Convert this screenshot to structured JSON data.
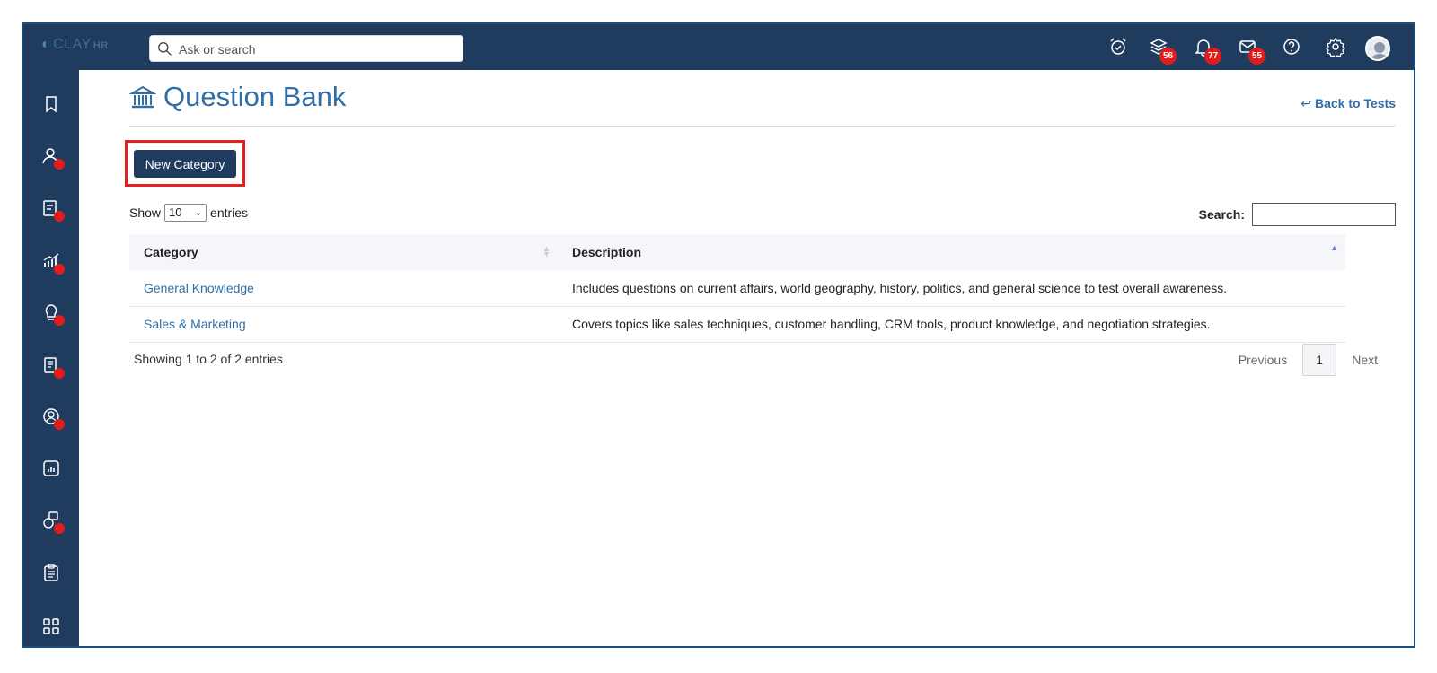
{
  "app": {
    "logo_text": "CLAY",
    "logo_suffix": "HR"
  },
  "search": {
    "placeholder": "Ask or search"
  },
  "topbar": {
    "icons": [
      "alarm-clock-icon",
      "layers-icon",
      "bell-icon",
      "mail-icon",
      "help-icon",
      "settings-icon"
    ],
    "badges": {
      "layers": "56",
      "bell": "77",
      "mail": "55"
    }
  },
  "sidebar": {
    "items": [
      {
        "icon": "bookmark-icon",
        "dot": false
      },
      {
        "icon": "people-icon",
        "dot": true
      },
      {
        "icon": "attendance-icon",
        "dot": true
      },
      {
        "icon": "growth-chart-icon",
        "dot": true
      },
      {
        "icon": "lightbulb-icon",
        "dot": true
      },
      {
        "icon": "document-icon",
        "dot": true
      },
      {
        "icon": "user-circle-icon",
        "dot": true
      },
      {
        "icon": "report-icon",
        "dot": false
      },
      {
        "icon": "support-icon",
        "dot": true
      },
      {
        "icon": "clipboard-icon",
        "dot": false
      },
      {
        "icon": "grid-icon",
        "dot": false
      }
    ]
  },
  "page": {
    "title": "Question Bank",
    "back_label": "Back to Tests",
    "new_category_label": "New Category"
  },
  "table_controls": {
    "show_label": "Show",
    "page_length": "10",
    "entries_label": "entries",
    "search_label": "Search:"
  },
  "table": {
    "columns": [
      "Category",
      "Description"
    ],
    "rows": [
      {
        "category": "General Knowledge",
        "description": "Includes questions on current affairs, world geography, history, politics, and general science to test overall awareness."
      },
      {
        "category": "Sales & Marketing",
        "description": "Covers topics like sales techniques, customer handling, CRM tools, product knowledge, and negotiation strategies."
      }
    ]
  },
  "footer": {
    "info_prefix": "Showing ",
    "info_from": "1",
    "info_mid1": " to ",
    "info_to": "2",
    "info_mid2": " of ",
    "info_total": "2",
    "info_suffix": " entries",
    "previous_label": "Previous",
    "current_page": "1",
    "next_label": "Next"
  },
  "colors": {
    "navy": "#1f3b5e",
    "link": "#2f6ea6",
    "badge": "#e21b1b",
    "highlight": "#e51e1e"
  }
}
